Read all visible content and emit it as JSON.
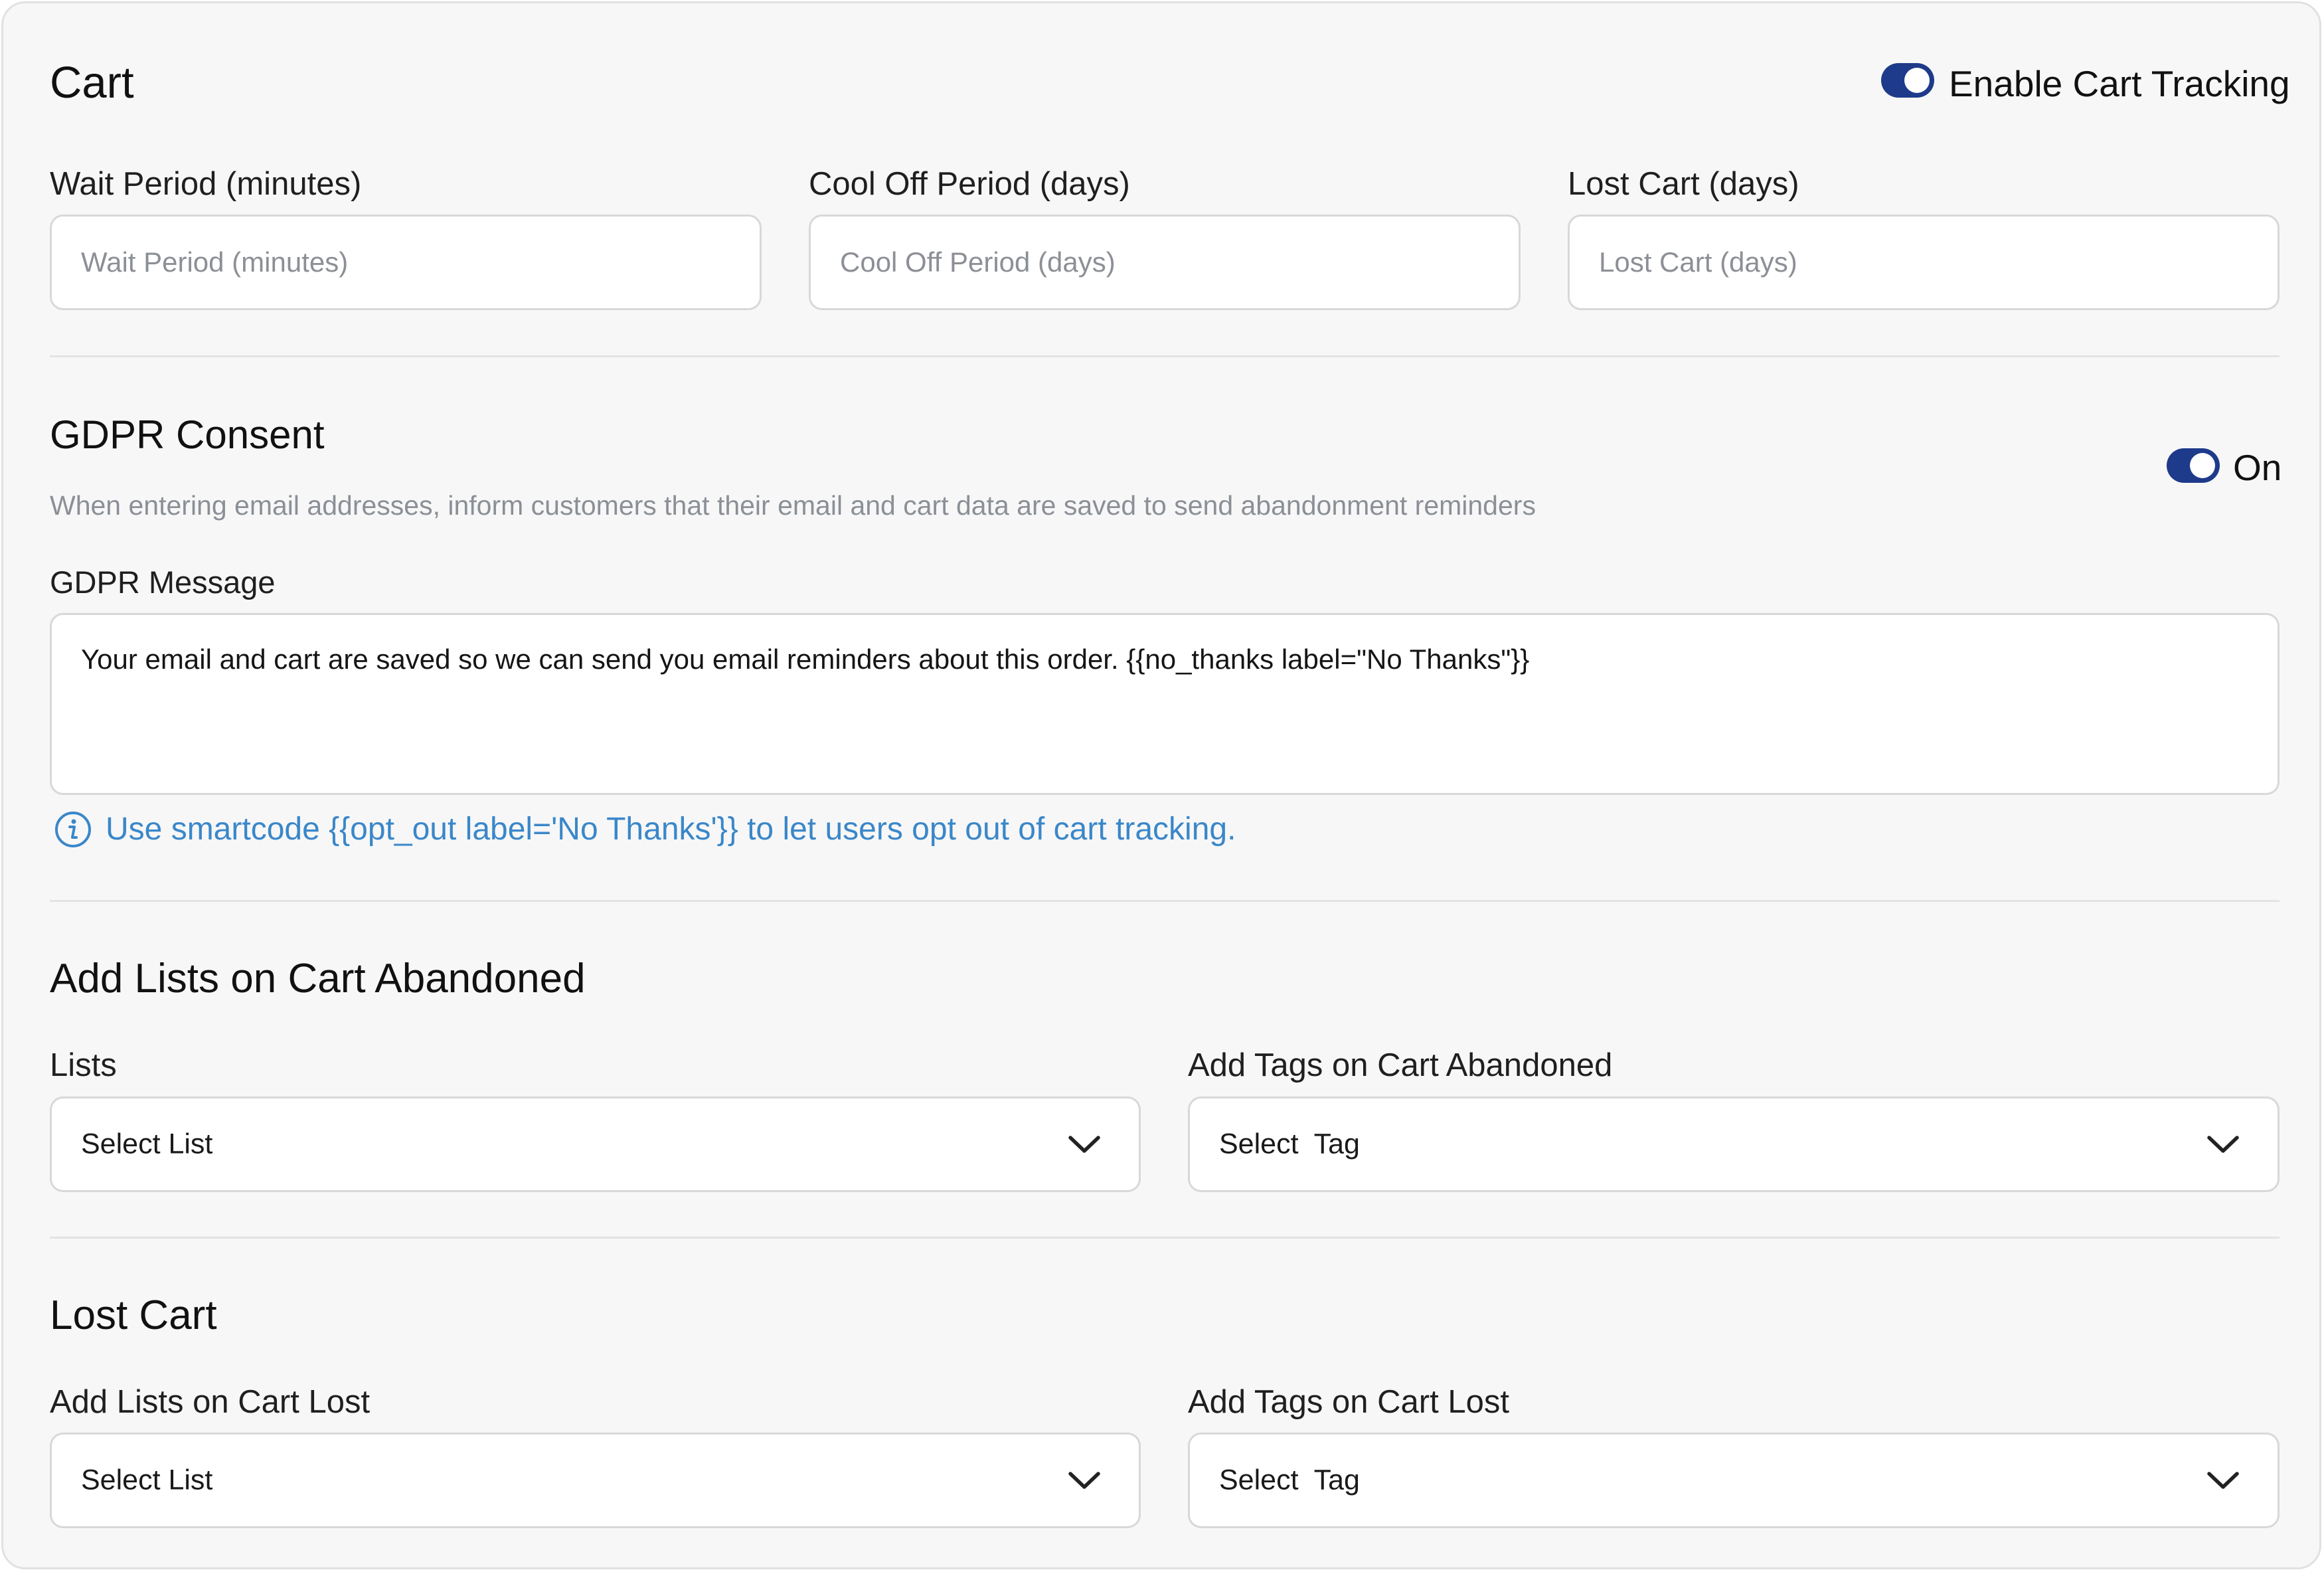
{
  "cart": {
    "title": "Cart",
    "tracking_toggle": {
      "label": "Enable Cart Tracking",
      "on": true
    },
    "fields": [
      {
        "label": "Wait Period (minutes)",
        "placeholder": "Wait Period (minutes)",
        "value": ""
      },
      {
        "label": "Cool Off Period (days)",
        "placeholder": "Cool Off Period (days)",
        "value": ""
      },
      {
        "label": "Lost Cart (days)",
        "placeholder": "Lost Cart (days)",
        "value": ""
      }
    ]
  },
  "gdpr": {
    "title": "GDPR Consent",
    "description": "When entering email addresses, inform customers that their email and cart data are saved to send abandonment reminders",
    "toggle": {
      "label": "On",
      "on": true
    },
    "message_label": "GDPR Message",
    "message_value": "Your email and cart are saved so we can send you email reminders about this order. {{no_thanks label=\"No Thanks\"}}",
    "hint": "Use smartcode {{opt_out label='No Thanks'}} to let users opt out of cart tracking.",
    "hint_icon": "info-circle-icon"
  },
  "abandoned": {
    "title": "Add Lists on Cart Abandoned",
    "lists_label": "Lists",
    "lists_select": "Select List",
    "tags_label": "Add Tags on Cart Abandoned",
    "tags_select": "Select  Tag"
  },
  "lost": {
    "title": "Lost Cart",
    "lists_label": "Add Lists on Cart Lost",
    "lists_select": "Select List",
    "tags_label": "Add Tags on Cart Lost",
    "tags_select": "Select  Tag"
  },
  "colors": {
    "toggle_on": "#1e3a8a",
    "hint": "#3a87c9",
    "background": "#f7f7f7"
  }
}
